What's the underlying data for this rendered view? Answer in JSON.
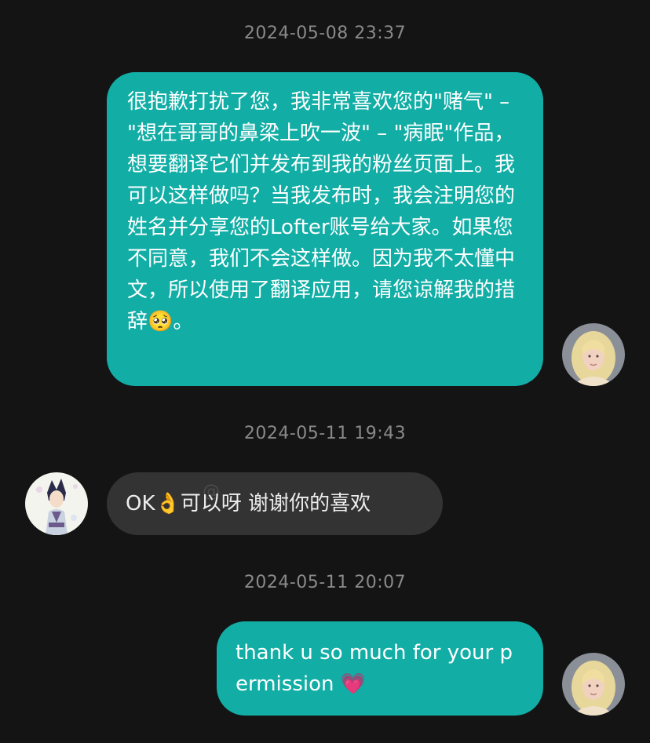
{
  "messages": [
    {
      "timestamp": "2024-05-08 23:37",
      "text": "很抱歉打扰了您，我非常喜欢您的\"赌气\" – \"想在哥哥的鼻梁上吹一波\" – \"病眠\"作品，想要翻译它们并发布到我的粉丝页面上。我可以这样做吗？当我发布时，我会注明您的姓名并分享您的Lofter账号给大家。如果您不同意，我们不会这样做。因为我不太懂中文，所以使用了翻译应用，请您谅解我的措辞🥺。"
    },
    {
      "timestamp": "2024-05-11 19:43",
      "text": "OK👌可以呀 谢谢你的喜欢"
    },
    {
      "timestamp": "2024-05-11 20:07",
      "text": "thank u so much for your permission 💗"
    }
  ],
  "colors": {
    "background": "#141414",
    "sent_bubble": "#12aea6",
    "received_bubble": "#333333",
    "timestamp": "#8a8a8a"
  },
  "avatars": {
    "self": "blonde-woman-avatar",
    "other": "anime-character-avatar"
  }
}
